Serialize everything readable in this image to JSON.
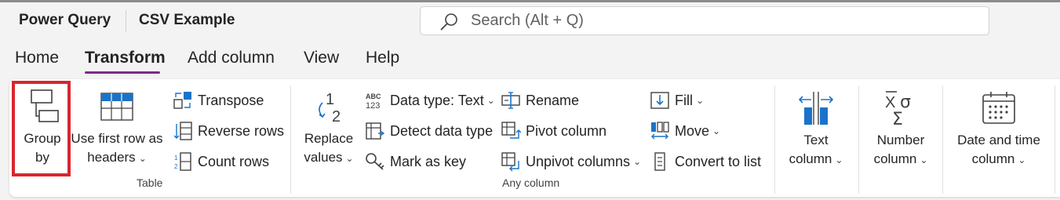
{
  "app": {
    "title": "Power Query",
    "document": "CSV Example"
  },
  "search": {
    "placeholder": "Search (Alt + Q)"
  },
  "tabs": [
    {
      "label": "Home",
      "active": false
    },
    {
      "label": "Transform",
      "active": true
    },
    {
      "label": "Add column",
      "active": false
    },
    {
      "label": "View",
      "active": false
    },
    {
      "label": "Help",
      "active": false
    }
  ],
  "ribbon": {
    "table_group": {
      "label": "Table",
      "group_by": {
        "line1": "Group",
        "line2": "by"
      },
      "first_row_headers": {
        "line1": "Use first row as",
        "line2": "headers"
      },
      "transpose": "Transpose",
      "reverse_rows": "Reverse rows",
      "count_rows": "Count rows"
    },
    "any_column_group": {
      "label": "Any column",
      "replace_values": {
        "line1": "Replace",
        "line2": "values"
      },
      "data_type": "Data type: Text",
      "detect_data_type": "Detect data type",
      "mark_as_key": "Mark as key",
      "rename": "Rename",
      "pivot_column": "Pivot column",
      "unpivot_columns": "Unpivot columns",
      "fill": "Fill",
      "move": "Move",
      "convert_to_list": "Convert to list"
    },
    "text_column": {
      "line1": "Text",
      "line2": "column"
    },
    "number_column": {
      "line1": "Number",
      "line2": "column"
    },
    "date_time_column": {
      "line1": "Date and time",
      "line2": "column"
    }
  },
  "accent": {
    "tab_underline": "#7a2a8a",
    "highlight": "#d9262e",
    "icon_blue": "#1a73c9"
  }
}
